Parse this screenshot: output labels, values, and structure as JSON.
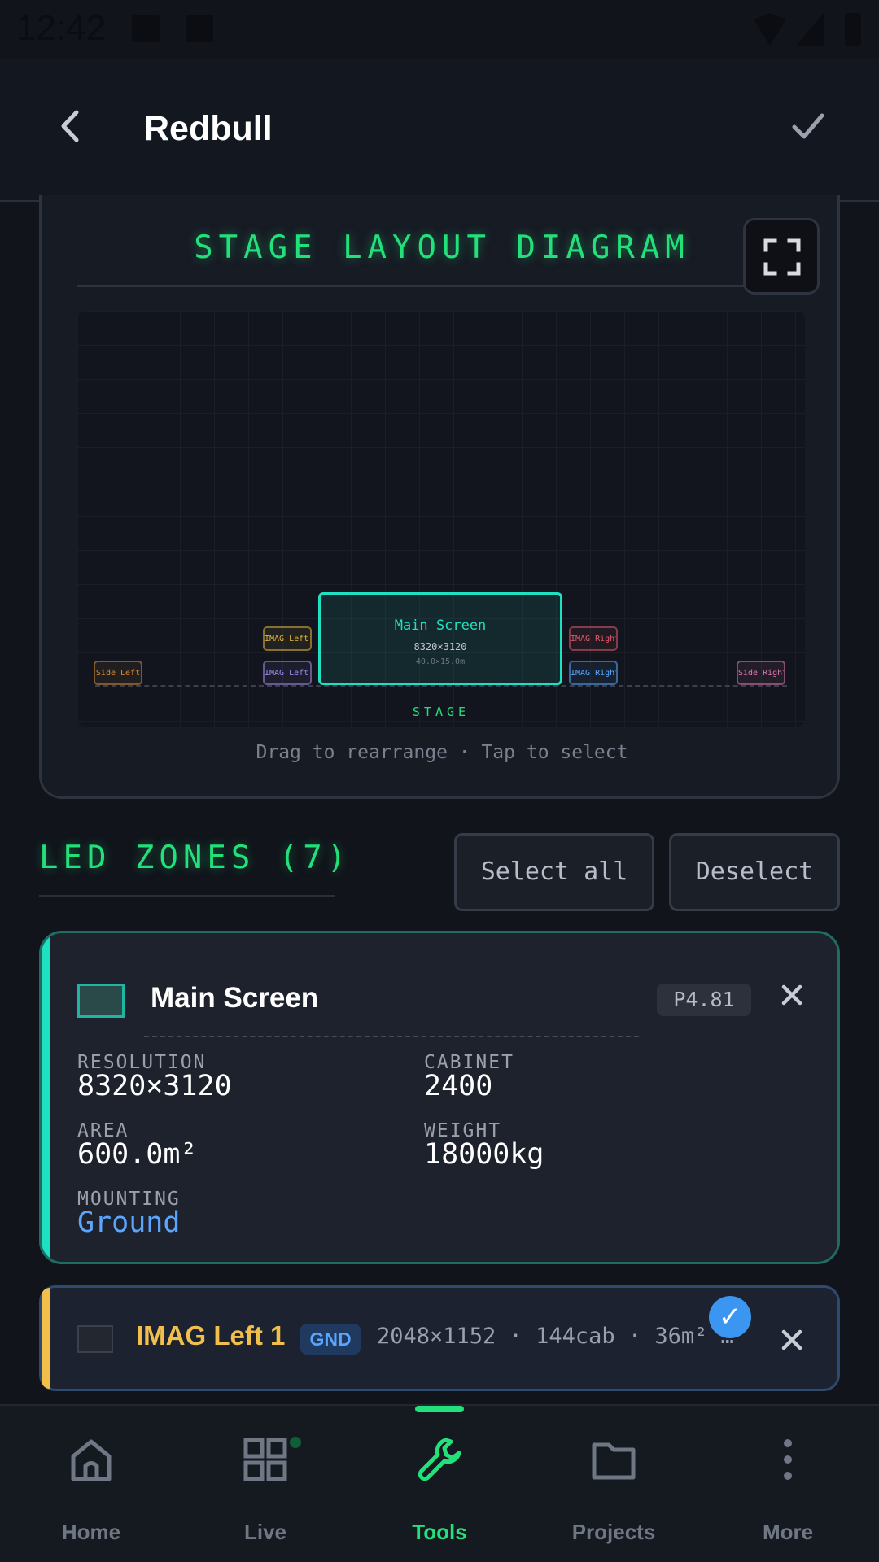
{
  "status_bar": {
    "time": "12:42"
  },
  "app_bar": {
    "title": "Redbull"
  },
  "diagram": {
    "title": "STAGE LAYOUT DIAGRAM",
    "hint": "Drag to rearrange · Tap to select",
    "stage_label": "STAGE",
    "zones": {
      "side_left": "Side Left",
      "imag_left_1": "IMAG Left 1",
      "imag_left_2": "IMAG Left 2",
      "main_name": "Main Screen",
      "main_res": "8320×3120",
      "main_dims": "40.0×15.0m",
      "imag_right_1": "IMAG Right 1",
      "imag_right_2": "IMAG Right 2",
      "side_right": "Side Right"
    },
    "colors": {
      "side_left": "#d98a3a",
      "imag_left_1": "#e0b840",
      "imag_left_2": "#a58cf0",
      "main": "#1fe0c0",
      "imag_right_1": "#e05a6a",
      "imag_right_2": "#5aa6ff",
      "side_right": "#e07ab0"
    }
  },
  "zones_section": {
    "title": "LED ZONES (7)",
    "select_all": "Select all",
    "deselect": "Deselect"
  },
  "main_zone_card": {
    "name": "Main Screen",
    "pitch": "P4.81",
    "resolution_label": "RESOLUTION",
    "resolution": "8320×3120",
    "cabinet_label": "CABINET",
    "cabinet": "2400",
    "area_label": "AREA",
    "area": "600.0m²",
    "weight_label": "WEIGHT",
    "weight": "18000kg",
    "mounting_label": "MOUNTING",
    "mounting": "Ground"
  },
  "zone_row": {
    "name": "IMAG Left 1",
    "badge": "GND",
    "meta": "2048×1152 · 144cab · 36m² · …",
    "selected_mark": "✓"
  },
  "nav": {
    "home": "Home",
    "live": "Live",
    "tools": "Tools",
    "projects": "Projects",
    "more": "More"
  }
}
